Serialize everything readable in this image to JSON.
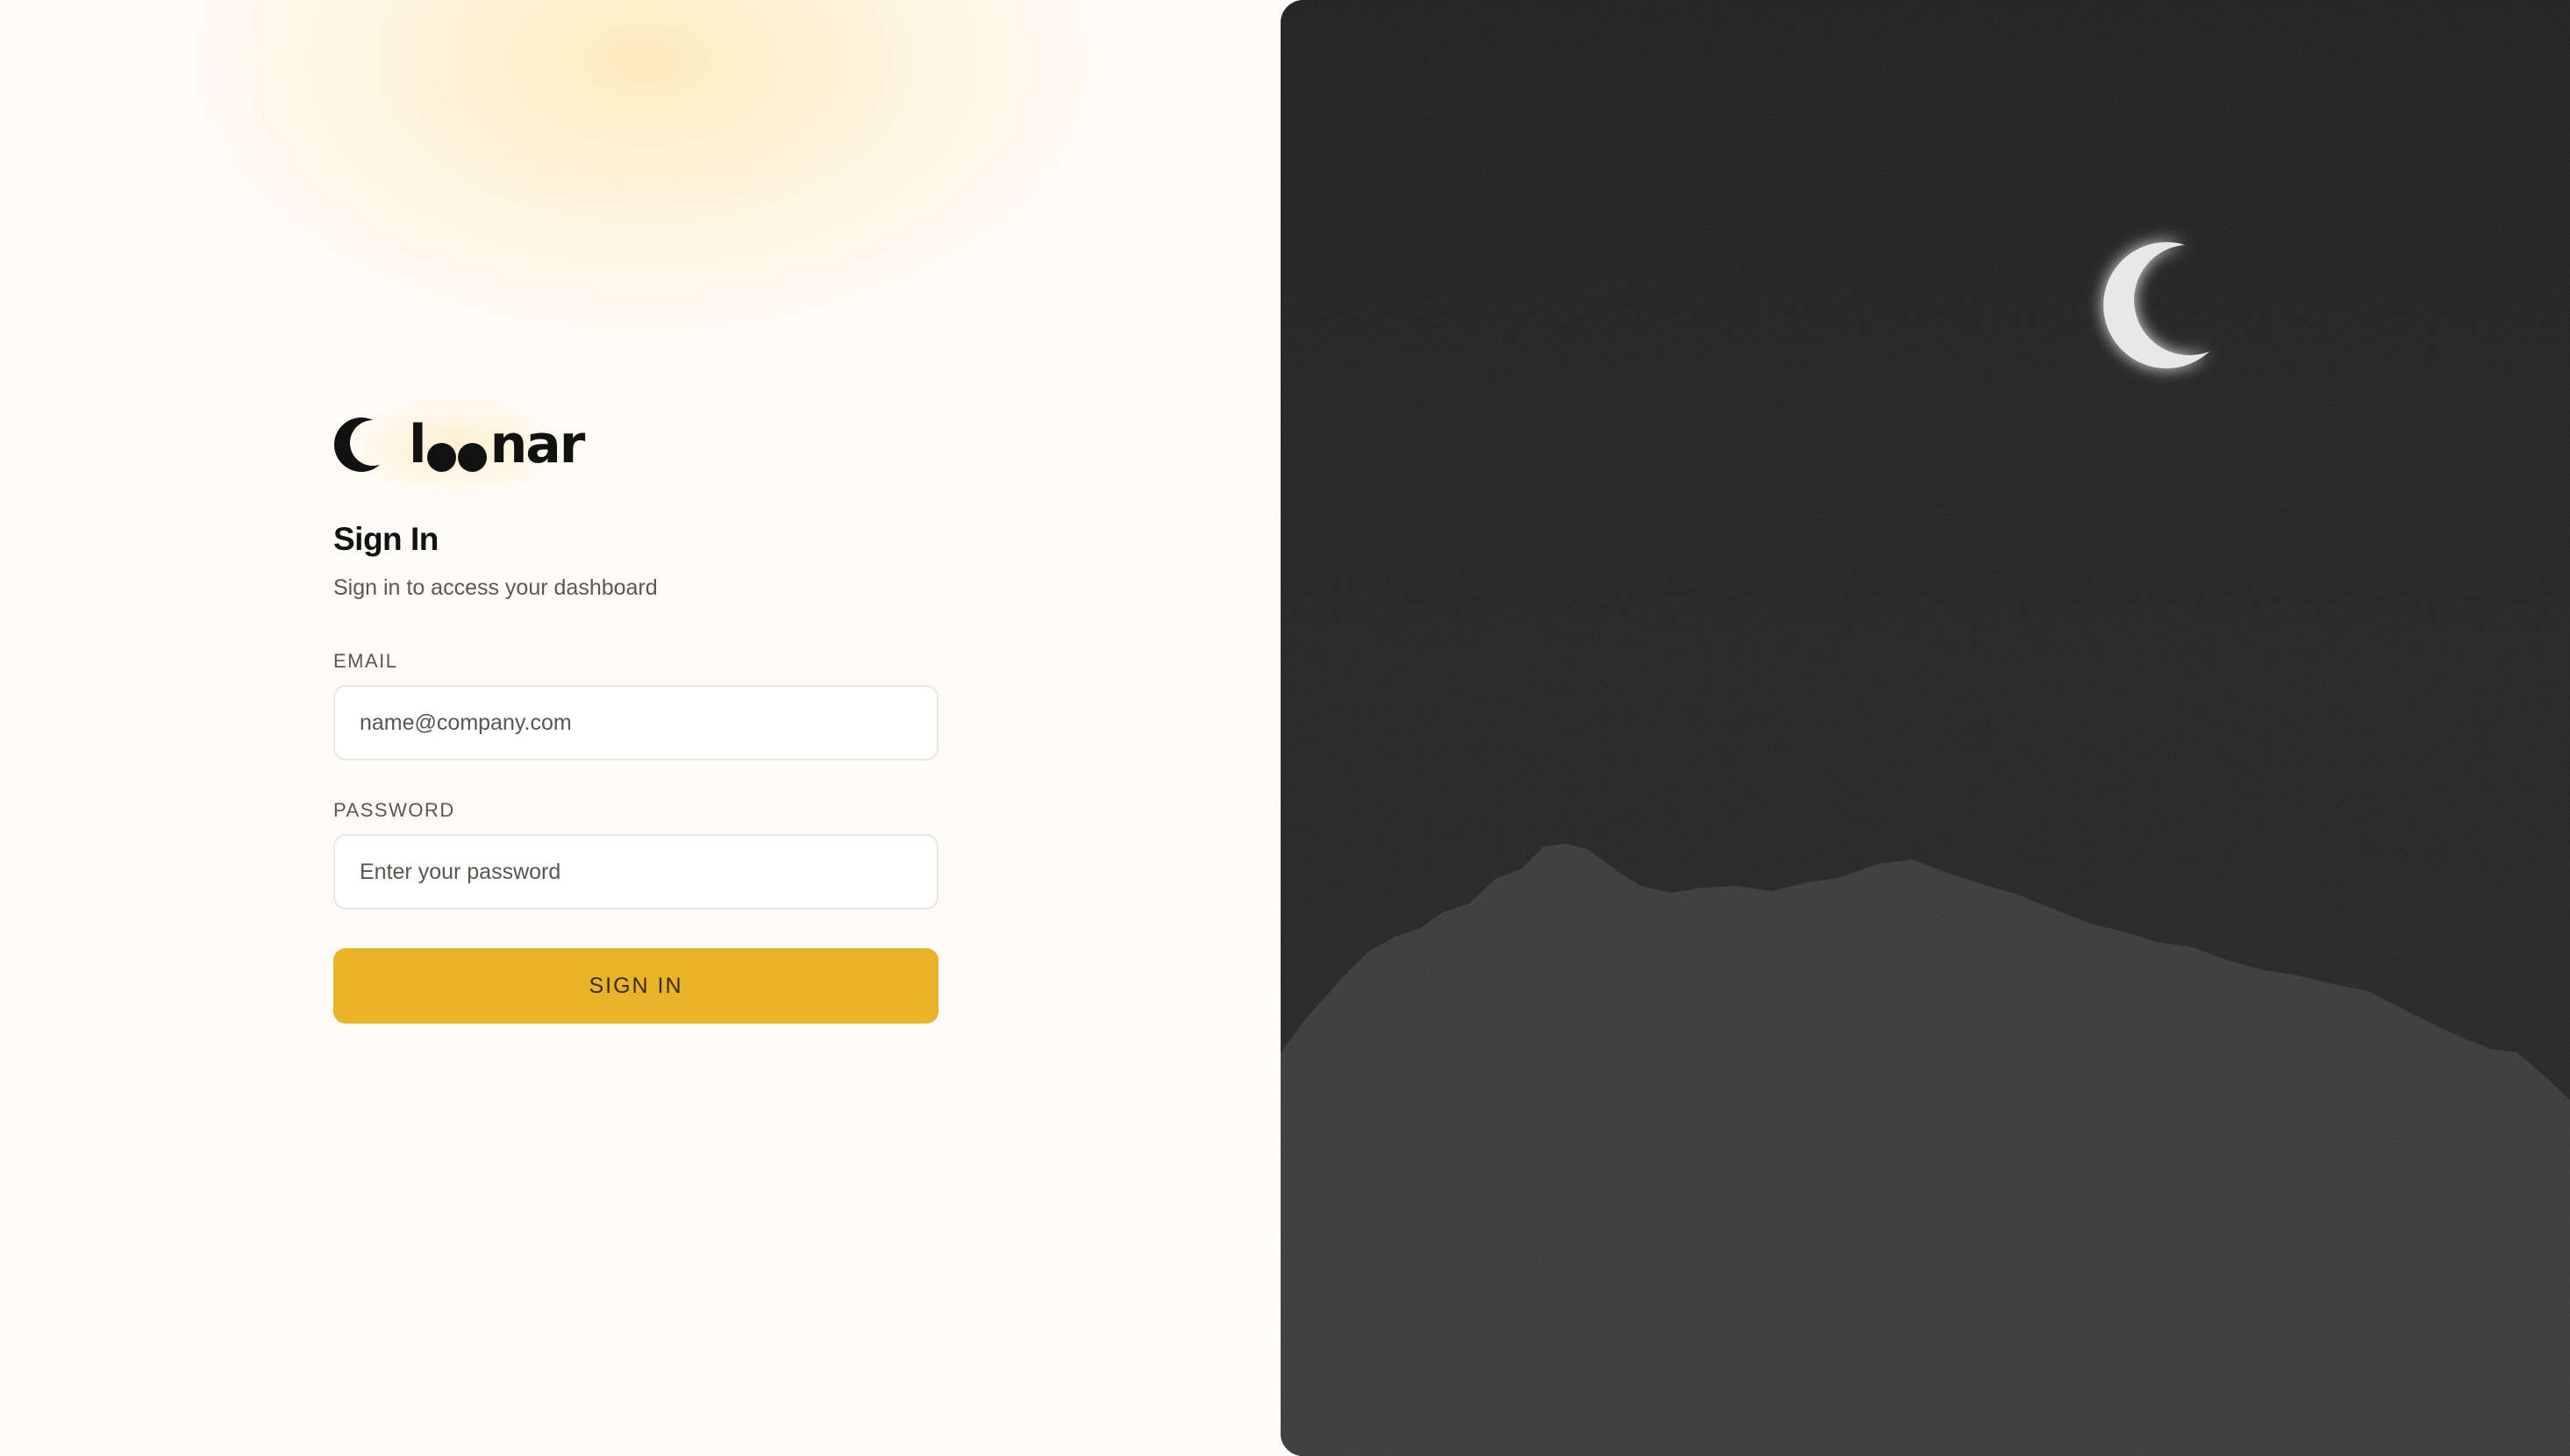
{
  "brand": {
    "name_prefix": "l",
    "name_suffix": "nar",
    "logo_icon": "crescent-moon-icon",
    "accent_color": "#eab42a"
  },
  "auth": {
    "title": "Sign In",
    "subtitle": "Sign in to access your dashboard",
    "email": {
      "label": "EMAIL",
      "placeholder": "name@company.com",
      "value": ""
    },
    "password": {
      "label": "PASSWORD",
      "placeholder": "Enter your password",
      "value": ""
    },
    "submit_label": "SIGN IN"
  },
  "hero": {
    "moon_icon": "crescent-moon-icon",
    "background_color": "#1b1b1b",
    "mountain_color": "#353535"
  }
}
